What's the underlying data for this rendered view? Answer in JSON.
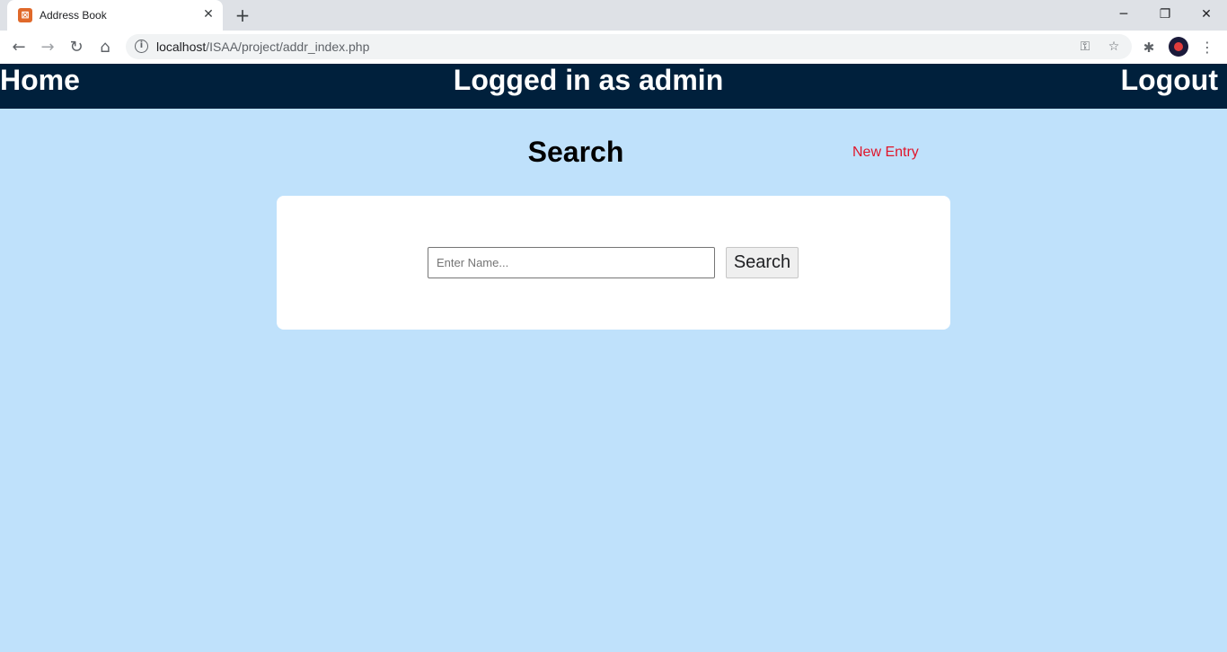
{
  "browser": {
    "tab_title": "Address Book",
    "tab_icon": "xampp-icon",
    "url_host": "localhost",
    "url_path": "/ISAA/project/addr_index.php"
  },
  "header": {
    "home_label": "Home",
    "status_text": "Logged in as admin",
    "logout_label": "Logout",
    "background_color": "#00203c"
  },
  "main": {
    "title": "Search",
    "new_entry_label": "New Entry",
    "new_entry_color": "#e0162b",
    "background_color": "#bfe1fb"
  },
  "search": {
    "placeholder": "Enter Name...",
    "value": "",
    "button_label": "Search"
  }
}
